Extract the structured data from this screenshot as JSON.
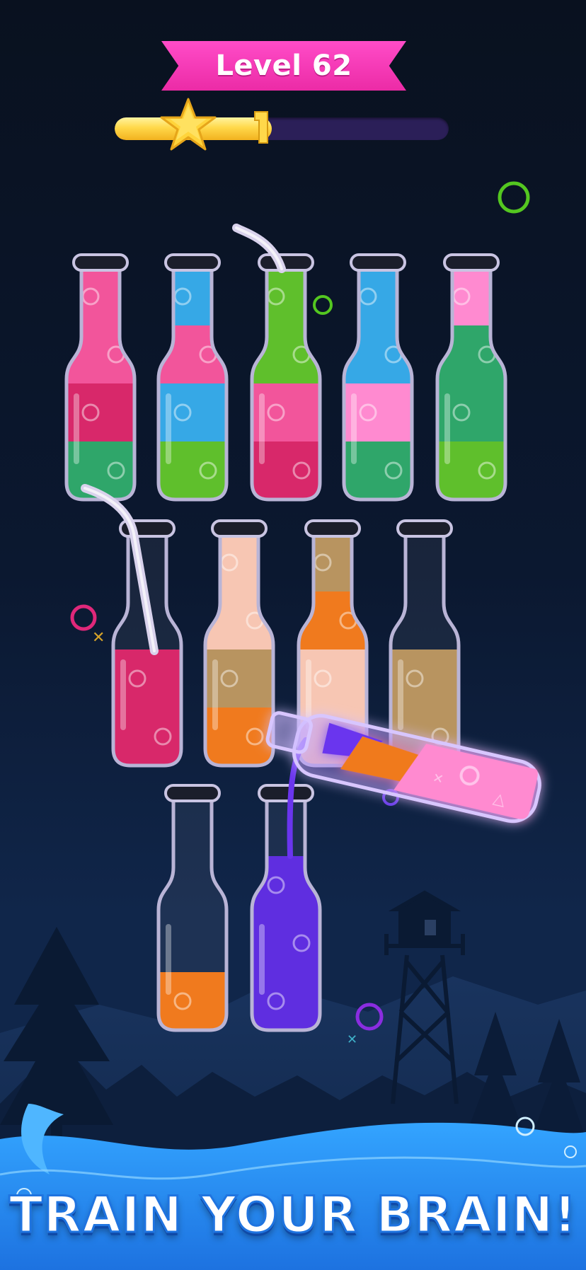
{
  "level": {
    "label": "Level 62"
  },
  "progress": {
    "value": 0.47,
    "star_icon": "star-icon",
    "marker_icon": "trophy-marker-icon"
  },
  "slogan": "TRAIN YOUR BRAIN!",
  "colors": {
    "pink": "#f2559b",
    "magenta": "#d8286a",
    "blue": "#36a8e6",
    "green": "#5fbf2c",
    "teal": "#2fa66a",
    "peach": "#f7c6b3",
    "tan": "#b89460",
    "orange": "#f07a1e",
    "purple": "#5f2ee0",
    "light_pink": "#ff8ad0"
  },
  "bottles": [
    {
      "id": "row1-1",
      "layers_top_to_bottom": [
        "pink",
        "pink",
        "magenta",
        "teal"
      ]
    },
    {
      "id": "row1-2",
      "layers_top_to_bottom": [
        "blue",
        "pink",
        "blue",
        "green"
      ]
    },
    {
      "id": "row1-3",
      "layers_top_to_bottom": [
        "green",
        "green",
        "pink",
        "magenta"
      ],
      "has_straw": true
    },
    {
      "id": "row1-4",
      "layers_top_to_bottom": [
        "blue",
        "blue",
        "light_pink",
        "teal"
      ]
    },
    {
      "id": "row1-5",
      "layers_top_to_bottom": [
        "light_pink",
        "teal",
        "teal",
        "green"
      ]
    },
    {
      "id": "row2-1",
      "layers_top_to_bottom": [
        "magenta",
        "magenta"
      ],
      "has_straw": true
    },
    {
      "id": "row2-2",
      "layers_top_to_bottom": [
        "peach",
        "peach",
        "tan",
        "orange"
      ]
    },
    {
      "id": "row2-3",
      "layers_top_to_bottom": [
        "tan",
        "orange",
        "peach",
        "peach"
      ]
    },
    {
      "id": "row2-4",
      "layers_top_to_bottom": [
        "tan",
        "tan"
      ]
    },
    {
      "id": "row3-1",
      "layers_top_to_bottom": [
        "orange"
      ]
    },
    {
      "id": "row3-2",
      "layers_top_to_bottom": [
        "purple",
        "purple",
        "purple"
      ]
    }
  ],
  "tilted_bottle": {
    "layers": [
      "purple",
      "orange",
      "light_pink",
      "light_pink"
    ],
    "state": "pouring"
  }
}
